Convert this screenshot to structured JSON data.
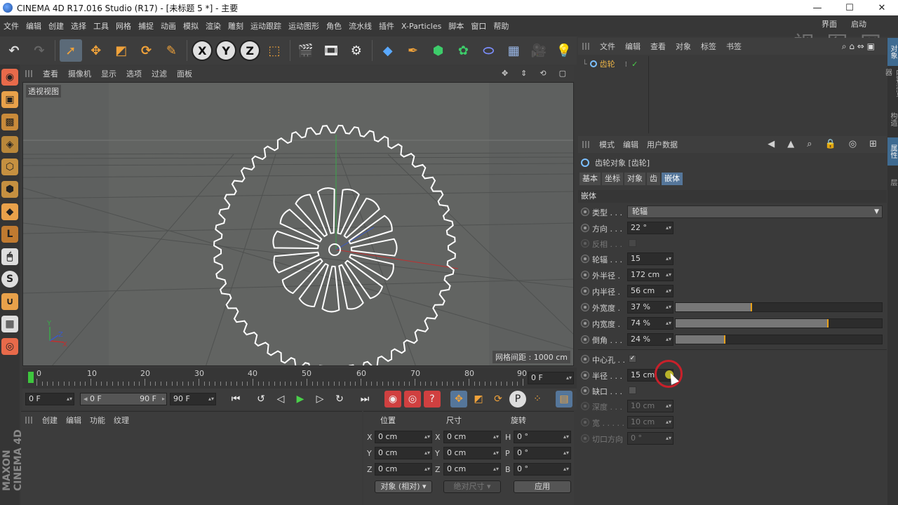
{
  "window": {
    "title": "CINEMA 4D R17.016 Studio (R17) - [未标题 5 *] - 主要",
    "minimize": "—",
    "maximize": "☐",
    "close": "✕"
  },
  "menubar": {
    "items": [
      "文件",
      "编辑",
      "创建",
      "选择",
      "工具",
      "网格",
      "捕捉",
      "动画",
      "模拟",
      "渲染",
      "雕刻",
      "运动跟踪",
      "运动图形",
      "角色",
      "流水线",
      "插件",
      "X-Particles",
      "脚本",
      "窗口",
      "帮助"
    ],
    "layout_label": "界面",
    "layout_value": "启动",
    "watermark": "视 图 网"
  },
  "toolbar": {
    "x": "X",
    "y": "Y",
    "z": "Z"
  },
  "viewport": {
    "menu": [
      "查看",
      "摄像机",
      "显示",
      "选项",
      "过滤",
      "面板"
    ],
    "view_name": "透视视图",
    "grid_spacing": "网格间距 : 1000 cm",
    "axis_y": "Y",
    "axis_z": "Z",
    "axis_x": "X"
  },
  "timeline": {
    "ticks": [
      "0",
      "10",
      "20",
      "30",
      "40",
      "50",
      "60",
      "70",
      "80",
      "90"
    ],
    "current_frame": "0 F"
  },
  "transport": {
    "start": "0 F",
    "range_start": "0 F",
    "range_end": "90 F",
    "end": "90 F"
  },
  "materials": {
    "menu": [
      "创建",
      "编辑",
      "功能",
      "纹理"
    ]
  },
  "coords": {
    "headers": [
      "位置",
      "尺寸",
      "旋转"
    ],
    "rows": [
      {
        "axis": "X",
        "pos": "0 cm",
        "size_axis": "X",
        "size": "0 cm",
        "rot_axis": "H",
        "rot": "0 °"
      },
      {
        "axis": "Y",
        "pos": "0 cm",
        "size_axis": "Y",
        "size": "0 cm",
        "rot_axis": "P",
        "rot": "0 °"
      },
      {
        "axis": "Z",
        "pos": "0 cm",
        "size_axis": "Z",
        "size": "0 cm",
        "rot_axis": "B",
        "rot": "0 °"
      }
    ],
    "mode": "对象 (相对)",
    "size_mode": "绝对尺寸",
    "apply": "应用"
  },
  "object_manager": {
    "menu": [
      "文件",
      "编辑",
      "查看",
      "对象",
      "标签",
      "书签"
    ],
    "objects": [
      {
        "name": "齿轮"
      }
    ]
  },
  "right_strip": [
    "对象",
    "内容浏览器",
    "构造",
    "属性",
    "层"
  ],
  "attributes": {
    "menu": [
      "模式",
      "编辑",
      "用户数据"
    ],
    "object_title": "齿轮对象 [齿轮]",
    "tabs": [
      "基本",
      "坐标",
      "对象",
      "齿",
      "嵌体"
    ],
    "active_tab": "嵌体",
    "section": "嵌体",
    "props": {
      "type": {
        "label": "类型 . . .",
        "value": "轮辐"
      },
      "direction": {
        "label": "方向 . . .",
        "value": "22 °"
      },
      "invert": {
        "label": "反相 . . ."
      },
      "spokes": {
        "label": "轮辐 . . .",
        "value": "15"
      },
      "outer_radius": {
        "label": "外半径 .",
        "value": "172 cm"
      },
      "inner_radius": {
        "label": "内半径 .",
        "value": "56 cm"
      },
      "outer_width": {
        "label": "外宽度 .",
        "value": "37 %",
        "fraction": 0.37
      },
      "inner_width": {
        "label": "内宽度 .",
        "value": "74 %",
        "fraction": 0.74
      },
      "bevel": {
        "label": "倒角 . . .",
        "value": "24 %",
        "fraction": 0.24
      },
      "center_hole": {
        "label": "中心孔 . .",
        "checked": "✓"
      },
      "radius": {
        "label": "半径 . . .",
        "value": "15 cm"
      },
      "notch": {
        "label": "缺口 . . ."
      },
      "depth": {
        "label": "深度 . . .",
        "value": "10 cm"
      },
      "width": {
        "label": "宽 . . . . .",
        "value": "10 cm"
      },
      "cut_dir": {
        "label": "切口方向",
        "value": "0 °"
      }
    }
  }
}
